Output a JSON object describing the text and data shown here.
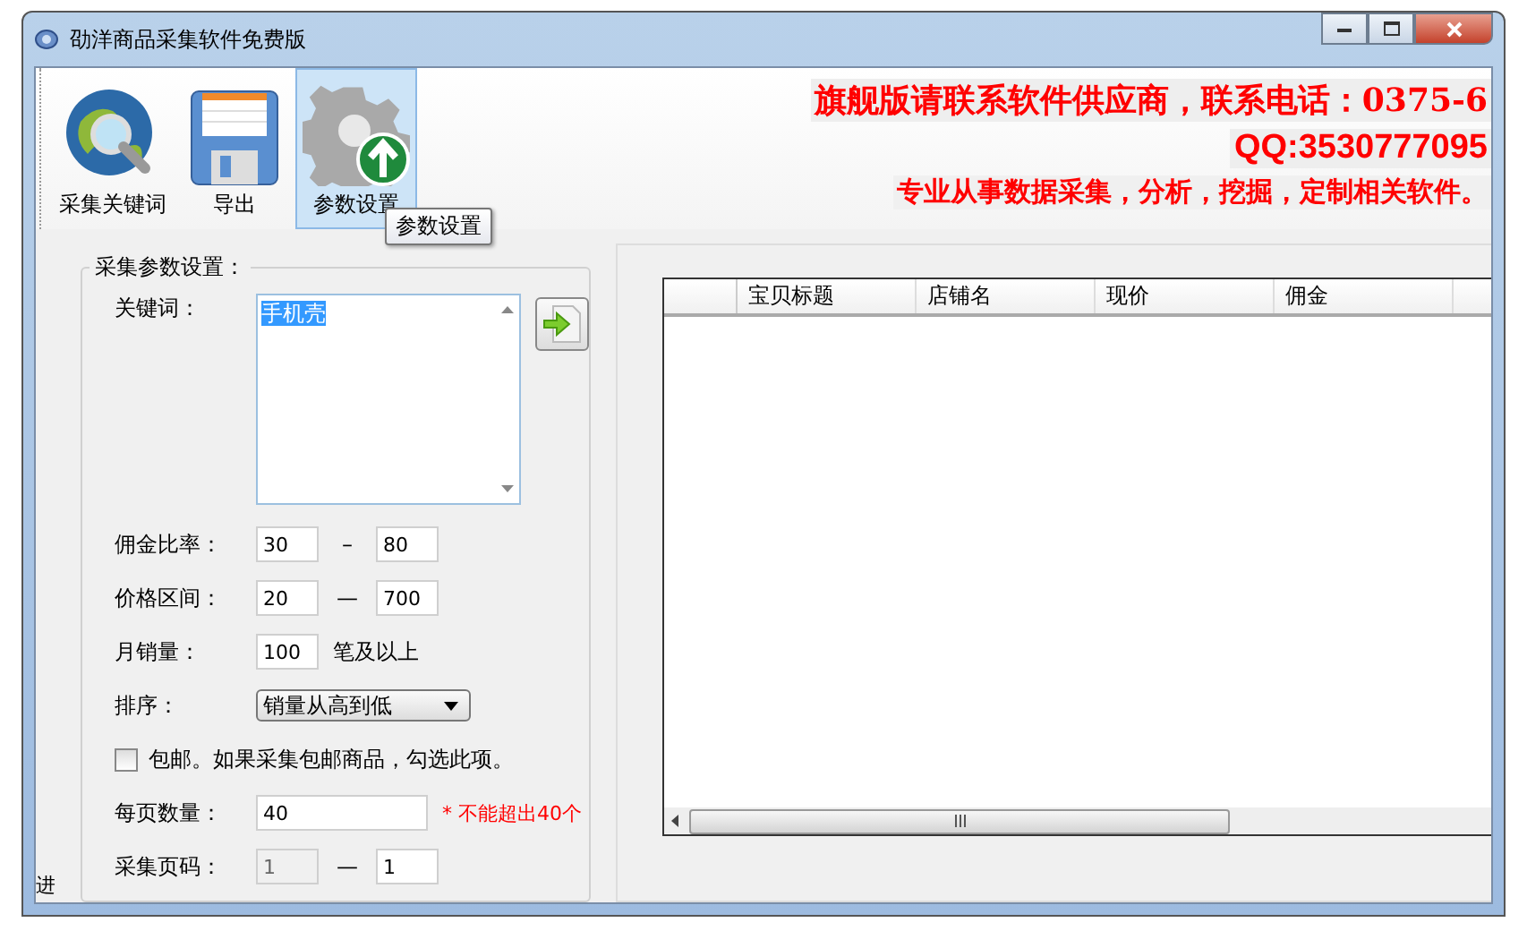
{
  "window": {
    "title": "劭洋商品采集软件免费版"
  },
  "toolbar": [
    {
      "label": "采集关键词",
      "selected": false
    },
    {
      "label": "导出",
      "selected": false
    },
    {
      "label": "参数设置",
      "selected": true
    }
  ],
  "tooltip": "参数设置",
  "banner": {
    "line_1": "旗舰版请联系软件供应商，联系电话：0375-6",
    "line_2": "QQ:3530777095",
    "line_3": "专业从事数据采集，分析，挖掘，定制相关软件。"
  },
  "settings": {
    "title": "采集参数设置：",
    "keyword": {
      "label": "关键词：",
      "value": "手机壳"
    },
    "commission": {
      "label": "佣金比率：",
      "from": "30",
      "separator": "–",
      "to": "80"
    },
    "price": {
      "label": "价格区间：",
      "from": "20",
      "separator": "—",
      "to": "700"
    },
    "monthly_sales": {
      "label": "月销量：",
      "value": "100",
      "suffix": "笔及以上"
    },
    "sort": {
      "label": "排序：",
      "value": "销量从高到低"
    },
    "free_shipping": {
      "label": "包邮。如果采集包邮商品，勾选此项。",
      "checked": false
    },
    "per_page": {
      "label": "每页数量：",
      "value": "40",
      "note": "* 不能超出40个"
    },
    "pages": {
      "label": "采集页码：",
      "from": "1",
      "from_disabled": true,
      "separator": "—",
      "to": "1"
    }
  },
  "table": {
    "columns": [
      "宝贝标题",
      "店铺名",
      "现价",
      "佣金"
    ]
  },
  "status_bar": "进"
}
